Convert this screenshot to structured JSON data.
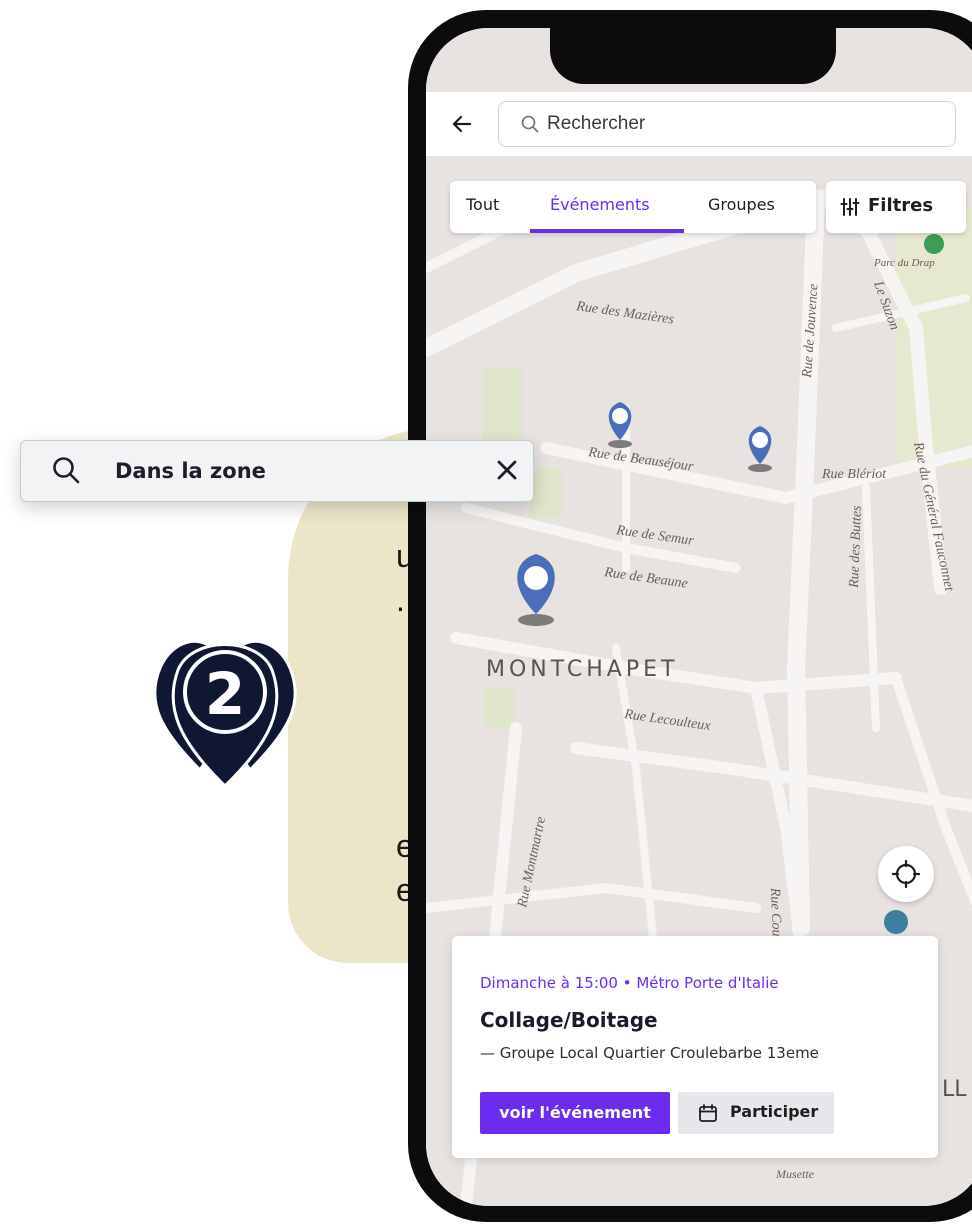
{
  "overlay": {
    "zone_search_text": "Dans la zone",
    "badge_number": "2",
    "partial_text_lines": [
      "ur",
      ".",
      "e",
      "e"
    ]
  },
  "header": {
    "search_placeholder": "Rechercher"
  },
  "tabs": [
    {
      "label": "Tout",
      "active": false
    },
    {
      "label": "Événements",
      "active": true
    },
    {
      "label": "Groupes",
      "active": false
    }
  ],
  "filters_label": "Filtres",
  "map": {
    "district": "MONTCHAPET",
    "streets": [
      "Rue des Mazières",
      "Rue de Beauséjour",
      "Rue de Semur",
      "Rue de Beaune",
      "Rue Lecoulteux",
      "Rue Montmartre",
      "Rue Courtépée",
      "Rue de Jouvence",
      "Rue Blériot",
      "Rue des Buttes",
      "Rue du Général Fauconnet",
      "Le Suzon",
      "Parc du Drap",
      "Musette",
      "LL"
    ]
  },
  "event_card": {
    "when": "Dimanche à 15:00 •  Métro Porte d'Italie",
    "title": "Collage/Boitage",
    "group": "— Groupe Local Quartier Croulebarbe 13eme",
    "primary_button": "voir l'événement",
    "secondary_button": "Participer"
  },
  "colors": {
    "accent": "#6b2cf0",
    "pin": "#4a6fb8",
    "badge": "#0f1733",
    "highlight_shape": "#ece6c8"
  }
}
